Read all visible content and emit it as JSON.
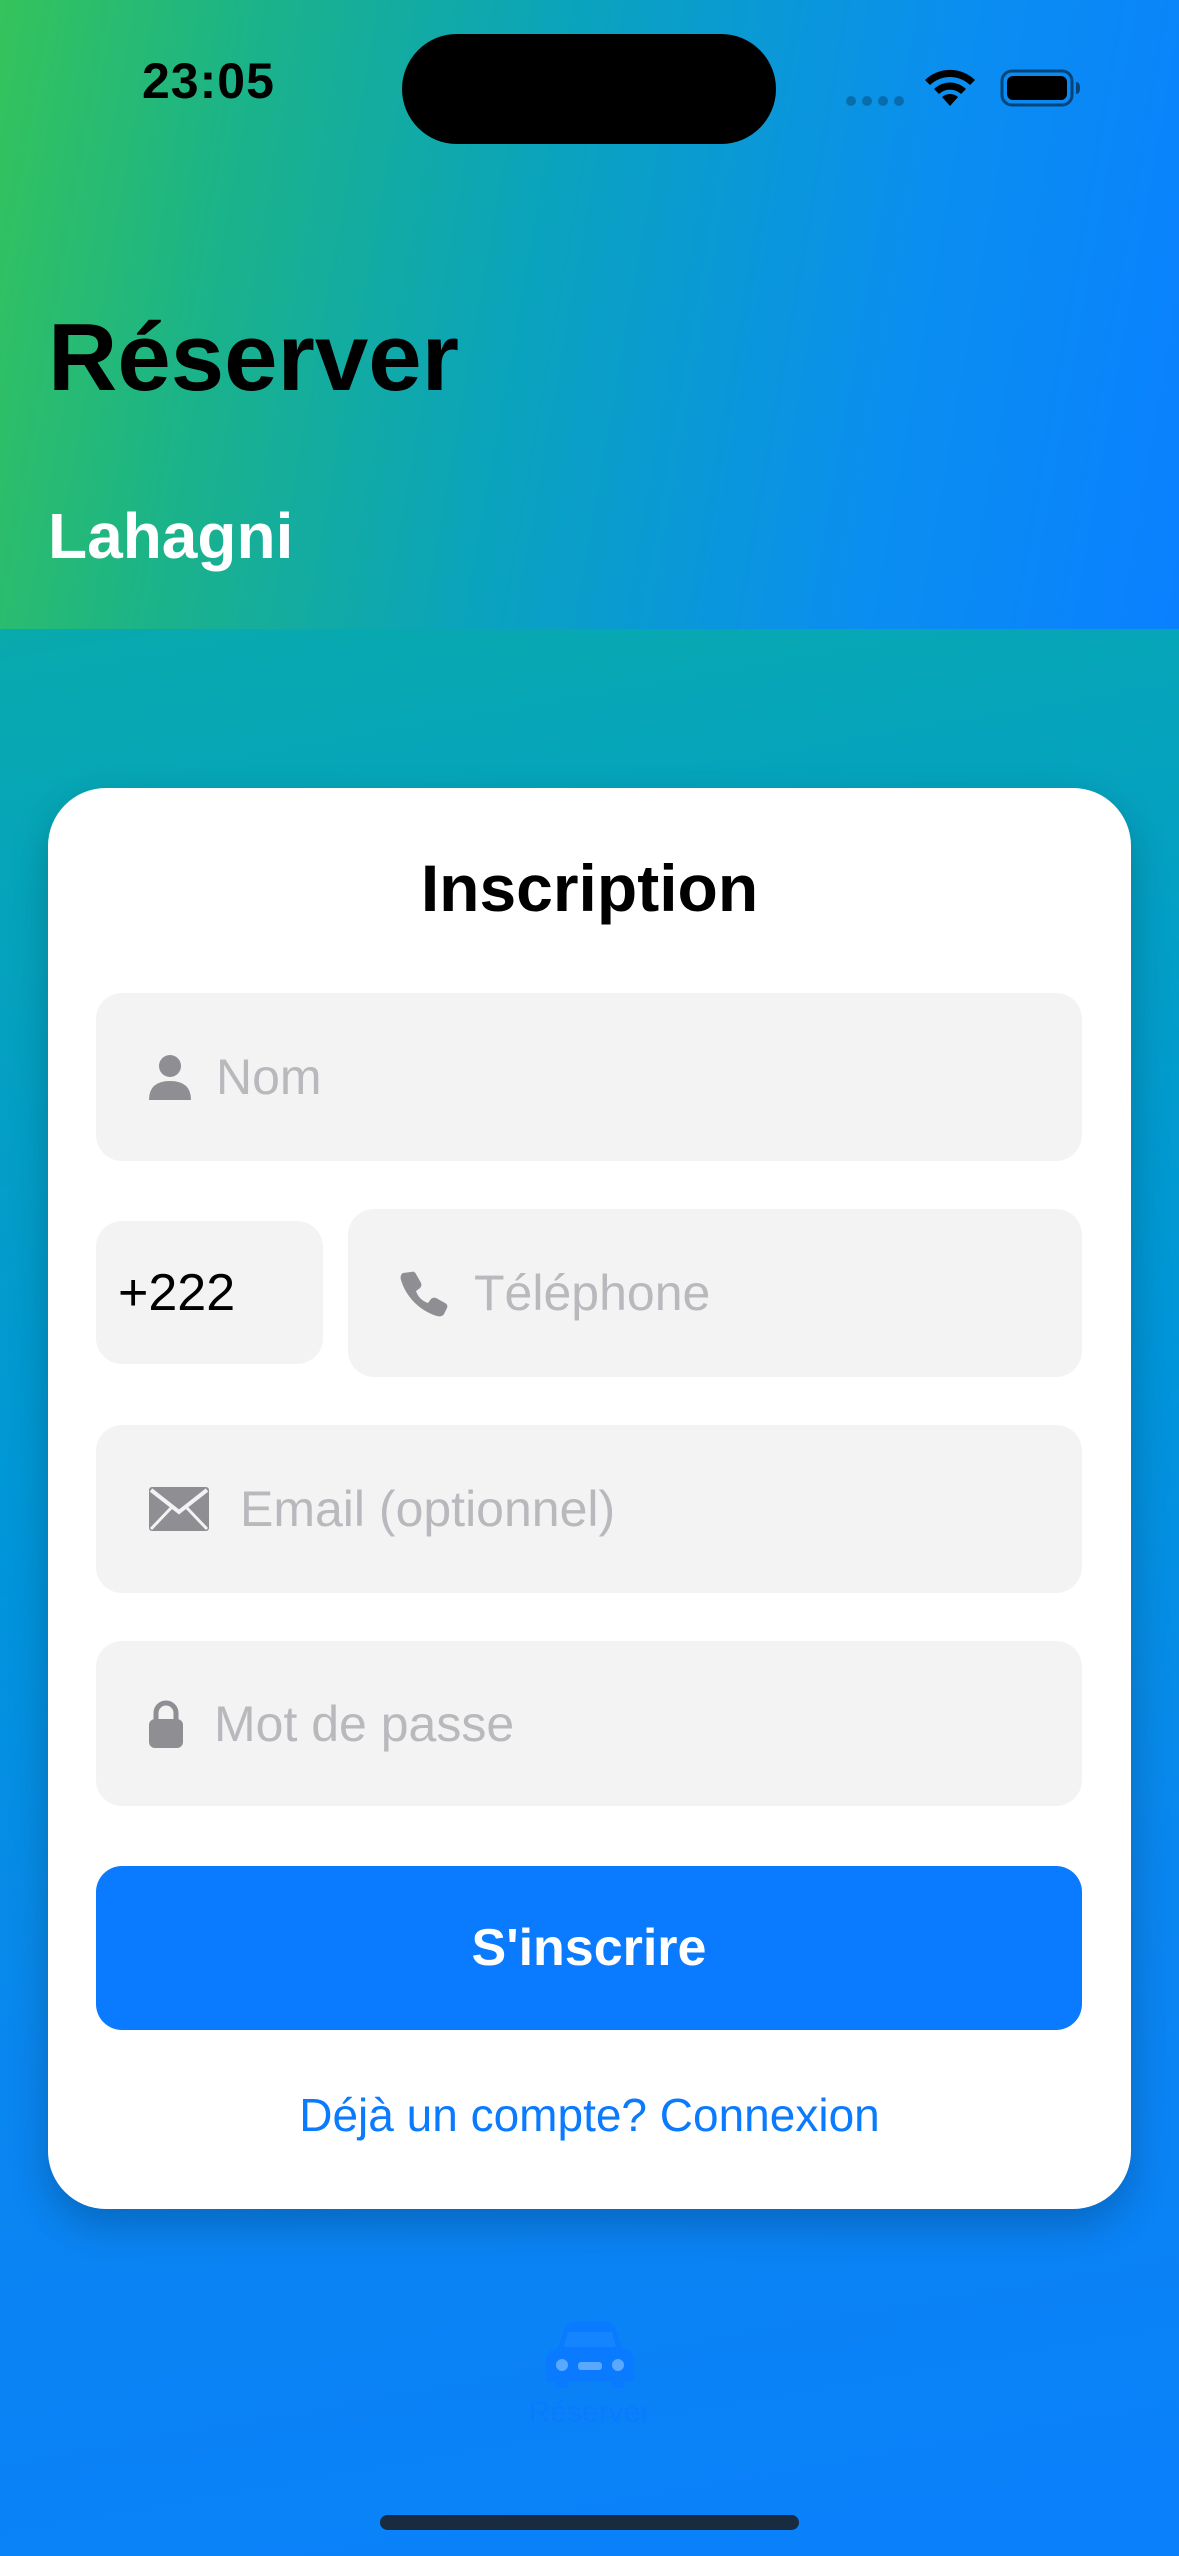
{
  "status_bar": {
    "time": "23:05",
    "icons": [
      "signal-dots-icon",
      "wifi-icon",
      "battery-icon"
    ]
  },
  "header": {
    "title": "Réserver",
    "subtitle": "Lahagni"
  },
  "signup_card": {
    "title": "Inscription",
    "name_field": {
      "icon": "person-icon",
      "placeholder": "Nom",
      "value": ""
    },
    "country_code": {
      "value": "+222"
    },
    "phone_field": {
      "icon": "phone-icon",
      "placeholder": "Téléphone",
      "value": ""
    },
    "email_field": {
      "icon": "envelope-icon",
      "placeholder": "Email (optionnel)",
      "value": ""
    },
    "password_field": {
      "icon": "lock-icon",
      "placeholder": "Mot de passe",
      "value": ""
    },
    "submit_label": "S'inscrire",
    "login_link": "Déjà un compte? Connexion"
  },
  "tab_bar": {
    "items": [
      {
        "icon": "car-icon",
        "label": "Réserver"
      }
    ]
  },
  "colors": {
    "accent": "#0A7AFF",
    "header_gradient_start": "#35C35B",
    "header_gradient_end": "#0A80FF",
    "field_background": "#F3F3F3",
    "placeholder_text": "#B9B9BD"
  }
}
